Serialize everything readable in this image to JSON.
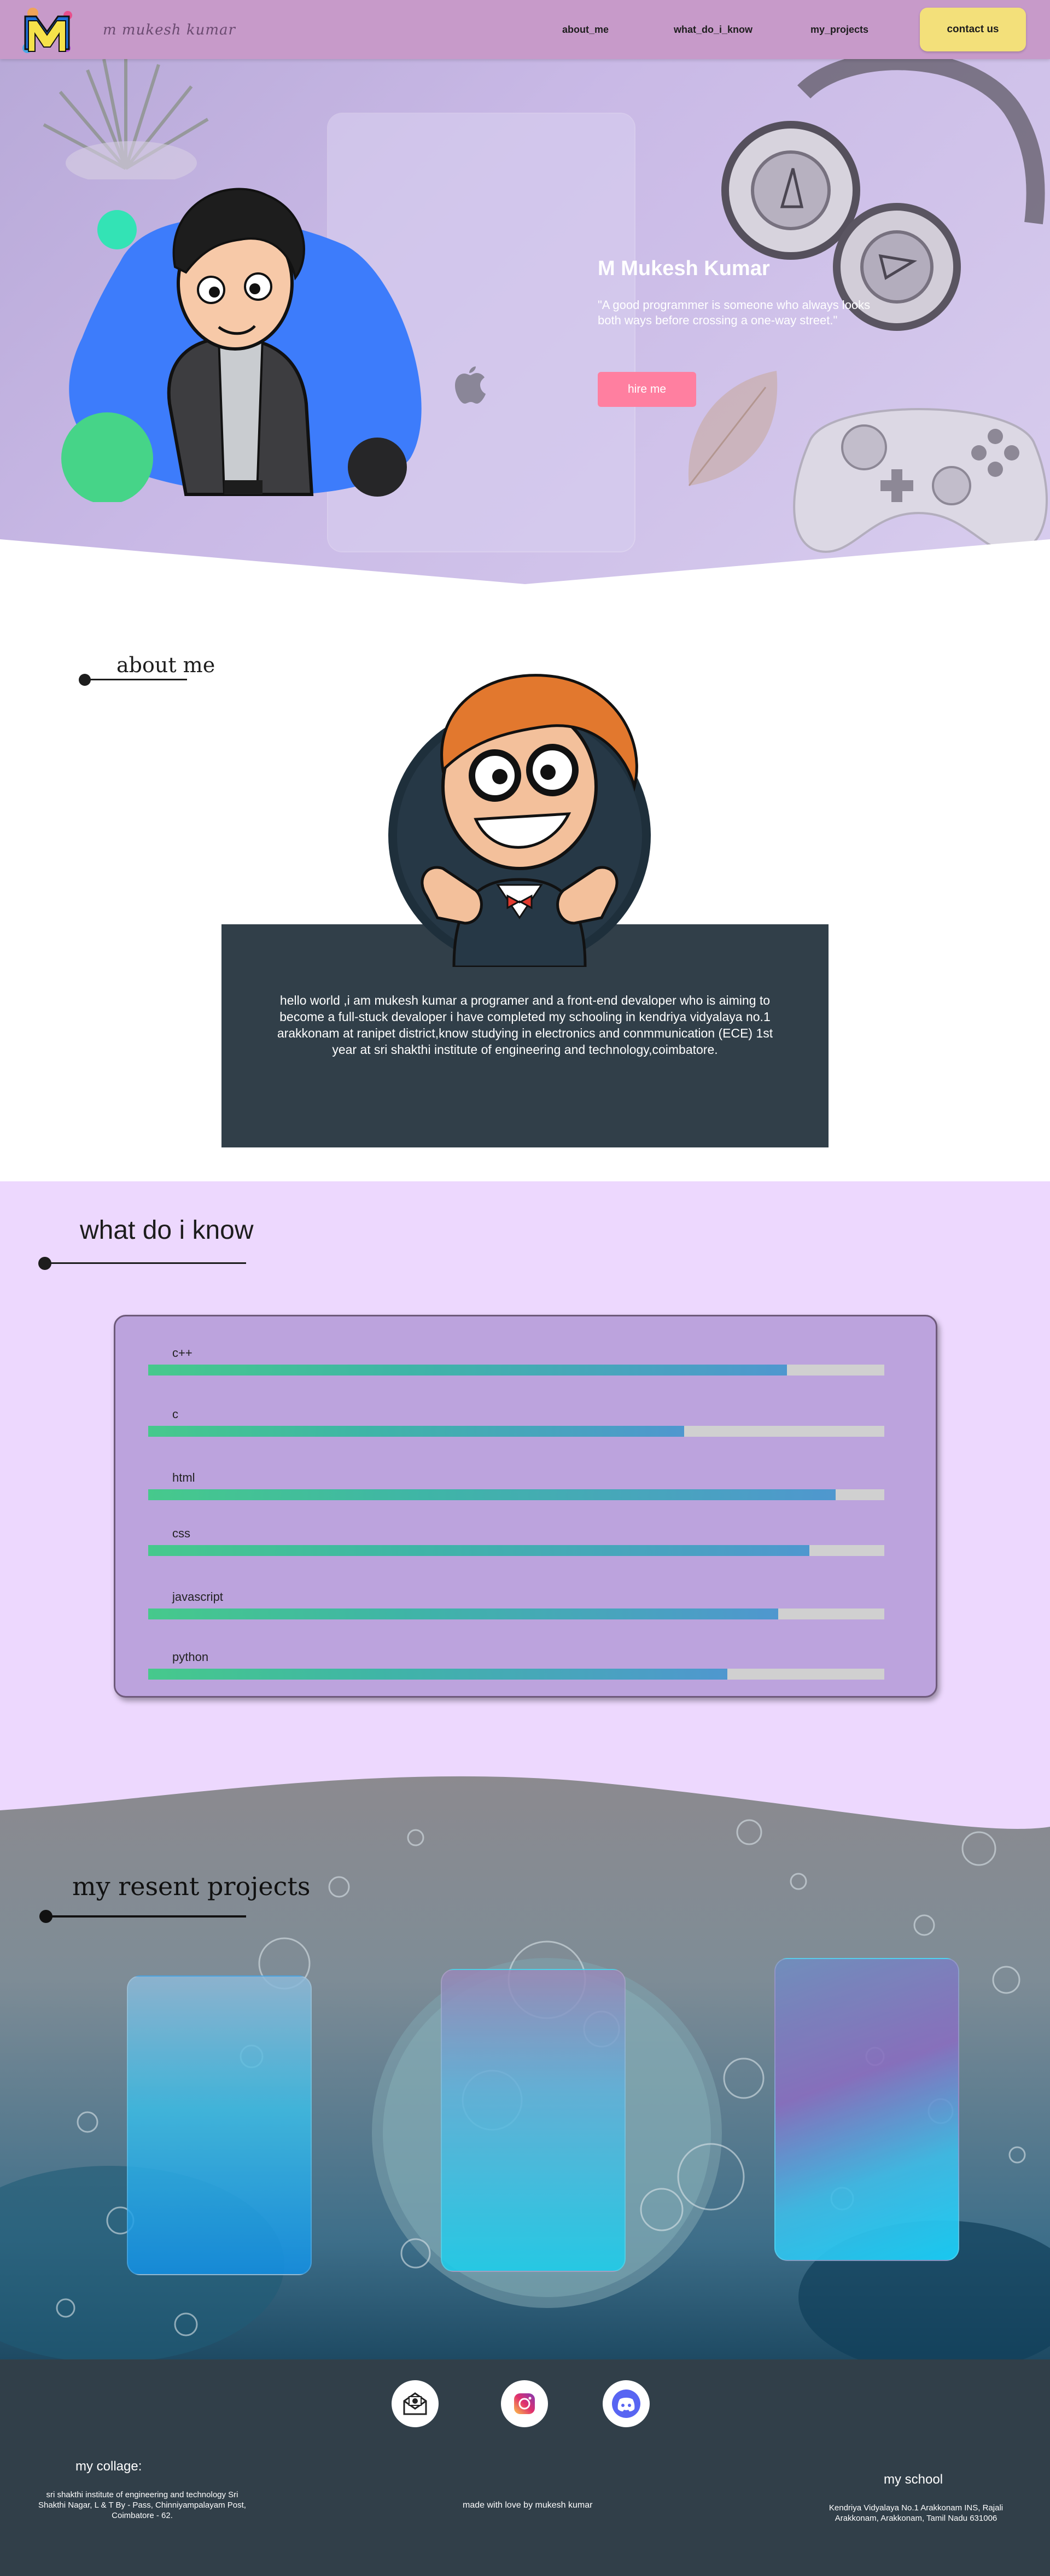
{
  "navbar": {
    "logo_alt": "M",
    "brand": "m mukesh kumar",
    "links": {
      "about": "about_me",
      "know": "what_do_i_know",
      "projects": "my_projects"
    },
    "contact_label": "contact us"
  },
  "hero": {
    "name": "M Mukesh Kumar",
    "quote": "\"A good programmer is someone who always looks both ways before crossing a one-way street.\"",
    "hire_label": "hire me"
  },
  "about": {
    "heading": "about me",
    "text": "hello world ,i am mukesh kumar a programer and a front-end devaloper who is aiming to become a full-stuck devaloper i have completed my schooling in kendriya vidyalaya no.1 arakkonam at ranipet district,know studying in electronics and conmmunication (ECE) 1st year at sri shakthi institute of engineering and technology,coimbatore."
  },
  "skills": {
    "heading": "what do i know",
    "items": [
      {
        "label": "c++",
        "level": 0.868
      },
      {
        "label": "c",
        "level": 0.728
      },
      {
        "label": "html",
        "level": 0.934
      },
      {
        "label": "css",
        "level": 0.898
      },
      {
        "label": "javascript",
        "level": 0.856
      },
      {
        "label": "python",
        "level": 0.787
      }
    ]
  },
  "projects": {
    "heading": "my resent projects"
  },
  "footer": {
    "college_title": "my collage:",
    "college_address": "sri shakthi institute of engineering and technology Sri Shakthi Nagar, L & T By - Pass, Chinniyampalayam Post, Coimbatore - 62.",
    "made_with": "made with love by mukesh kumar",
    "school_title": "my school",
    "school_address": "Kendriya Vidyalaya No.1 Arakkonam INS, Rajali Arakkonam, Arakkonam, Tamil Nadu 631006"
  },
  "colors": {
    "navbar": "#c79ac9",
    "contact_button": "#f3e07a",
    "hire_button": "#ff7fa0",
    "dark_panel": "#313f49",
    "skills_bg": "#edd8fe",
    "skills_card": "#bca3dd",
    "skill_fill_start": "#46c98c",
    "skill_fill_end": "#4f97cf"
  }
}
